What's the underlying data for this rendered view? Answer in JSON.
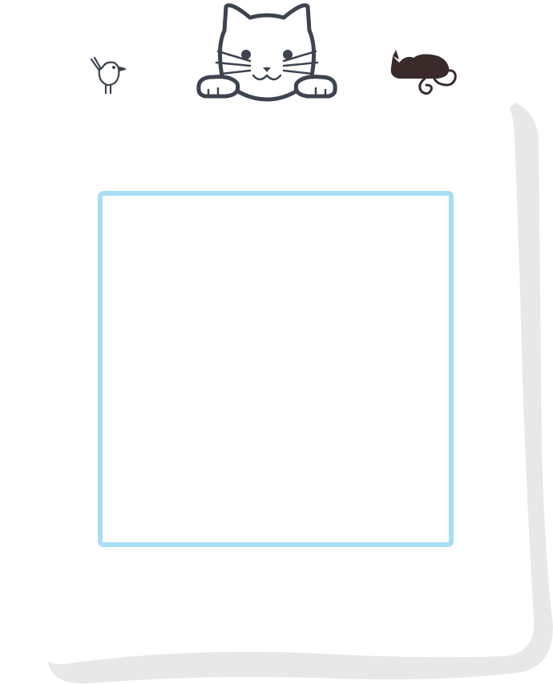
{
  "decorations": {
    "left_icon": "bird-icon",
    "center_icon": "cat-face-icon",
    "right_icon": "sleeping-cat-icon"
  },
  "card": {
    "frame_color": "#a7def5",
    "shadow_color": "#e8e8e8",
    "line_color": "#3d4450",
    "accent_dark": "#3b2a2a"
  }
}
